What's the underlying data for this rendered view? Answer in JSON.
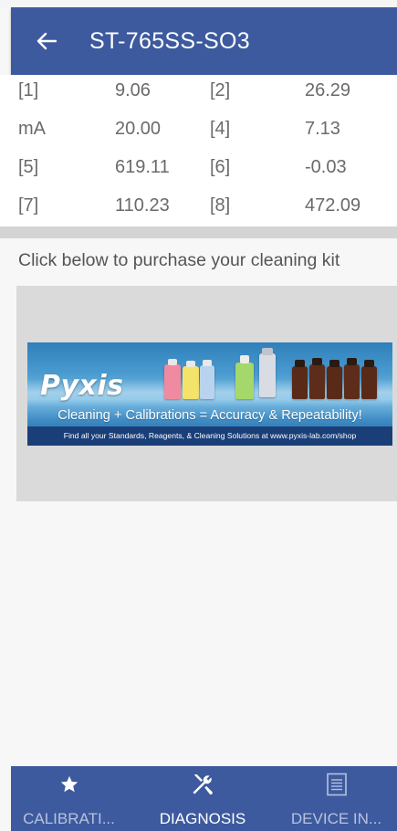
{
  "header": {
    "title": "ST-765SS-SO3",
    "back_icon": "arrow-left-icon"
  },
  "readings": {
    "rows": [
      [
        "[1]",
        "9.06",
        "[2]",
        "26.29"
      ],
      [
        "mA",
        "20.00",
        "[4]",
        "7.13"
      ],
      [
        "[5]",
        "619.11",
        "[6]",
        "-0.03"
      ],
      [
        "[7]",
        "110.23",
        "[8]",
        "472.09"
      ]
    ]
  },
  "promo": {
    "text": "Click below to purchase your cleaning kit",
    "banner": {
      "logo": "Pyxis",
      "tagline": "Cleaning + Calibrations = Accuracy & Repeatability!",
      "subline": "Find all your Standards, Reagents, & Cleaning Solutions at www.pyxis-lab.com/shop"
    }
  },
  "bottom_nav": {
    "items": [
      {
        "label": "CALIBRATI...",
        "icon": "star-icon",
        "active": false
      },
      {
        "label": "DIAGNOSIS",
        "icon": "wrench-screwdriver-icon",
        "active": true
      },
      {
        "label": "DEVICE IN...",
        "icon": "document-list-icon",
        "active": false
      }
    ]
  },
  "colors": {
    "primary": "#3d5a9f",
    "active_label": "#ffffff",
    "inactive_label": "#b8c2dd",
    "value_text": "#6a6a6a"
  }
}
